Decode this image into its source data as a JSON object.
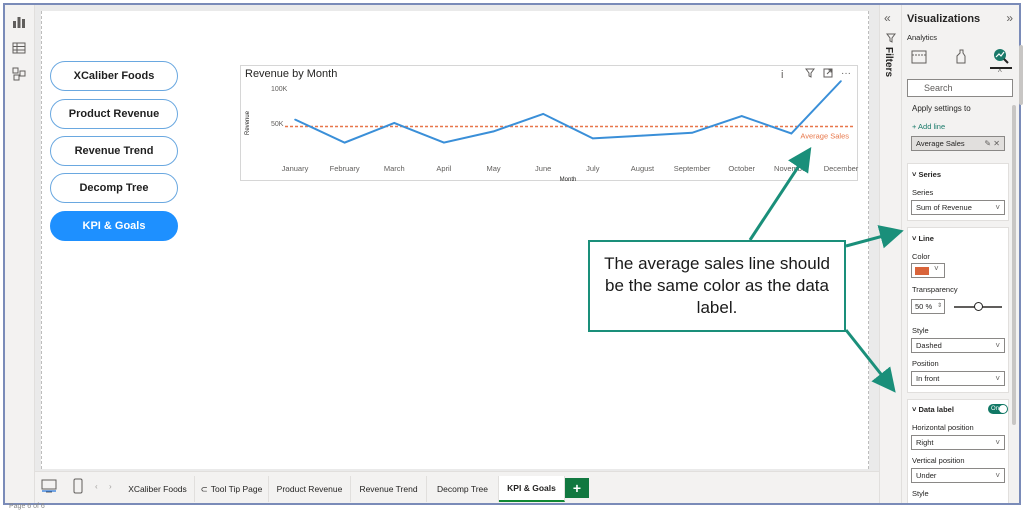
{
  "nav_buttons": [
    {
      "label": "XCaliber Foods",
      "active": false
    },
    {
      "label": "Product Revenue",
      "active": false
    },
    {
      "label": "Revenue Trend",
      "active": false
    },
    {
      "label": "Decomp Tree",
      "active": false
    },
    {
      "label": "KPI & Goals",
      "active": true
    }
  ],
  "visual": {
    "title": "Revenue by Month",
    "average_label": "Average Sales"
  },
  "chart_data": {
    "type": "line",
    "title": "Revenue by Month",
    "xlabel": "Month",
    "ylabel": "Revenue",
    "categories": [
      "January",
      "February",
      "March",
      "April",
      "May",
      "June",
      "July",
      "August",
      "September",
      "October",
      "November",
      "December"
    ],
    "series": [
      {
        "name": "Sum of Revenue",
        "values": [
          55000,
          22000,
          50000,
          22000,
          38000,
          63000,
          28000,
          32000,
          36000,
          60000,
          35000,
          110000
        ]
      }
    ],
    "ylim": [
      0,
      100000
    ],
    "yticks": [
      {
        "value": 100000,
        "label": "100K"
      },
      {
        "value": 50000,
        "label": "50K"
      }
    ],
    "reference_line": {
      "name": "Average Sales",
      "value": 45000,
      "color": "#e8774a",
      "style": "dashed"
    },
    "line_color": "#3a8fd8",
    "grid": false
  },
  "tabs": [
    {
      "label": "XCaliber Foods",
      "active": false
    },
    {
      "label": "Tool Tip Page",
      "active": false
    },
    {
      "label": "Product Revenue",
      "active": false
    },
    {
      "label": "Revenue Trend",
      "active": false
    },
    {
      "label": "Decomp Tree",
      "active": false
    },
    {
      "label": "KPI & Goals",
      "active": true
    }
  ],
  "tab_add_label": "+",
  "page_count": "Page 6 of 6",
  "filters_label": "Filters",
  "viz_pane": {
    "title": "Visualizations",
    "subtitle": "Analytics",
    "search_placeholder": "Search",
    "apply_settings": "Apply settings to",
    "add_line": "+ Add line",
    "selected_line": "Average Sales",
    "series_head": "Series",
    "series_label": "Series",
    "series_value": "Sum of Revenue",
    "line_head": "Line",
    "color_label": "Color",
    "color_swatch": "#d9643a",
    "transparency_label": "Transparency",
    "transparency_value": "50",
    "transparency_unit": "%",
    "transparency_level": 0.5,
    "style_label": "Style",
    "style_value": "Dashed",
    "position_label": "Position",
    "position_value": "In front",
    "data_label_head": "Data label",
    "toggle_label": "On",
    "hpos_label": "Horizontal position",
    "hpos_value": "Right",
    "vpos_label": "Vertical position",
    "vpos_value": "Under",
    "style2_label": "Style"
  },
  "callout": {
    "text": "The average sales line should be the same color as the data label.",
    "border_color": "#1a8f7a"
  }
}
